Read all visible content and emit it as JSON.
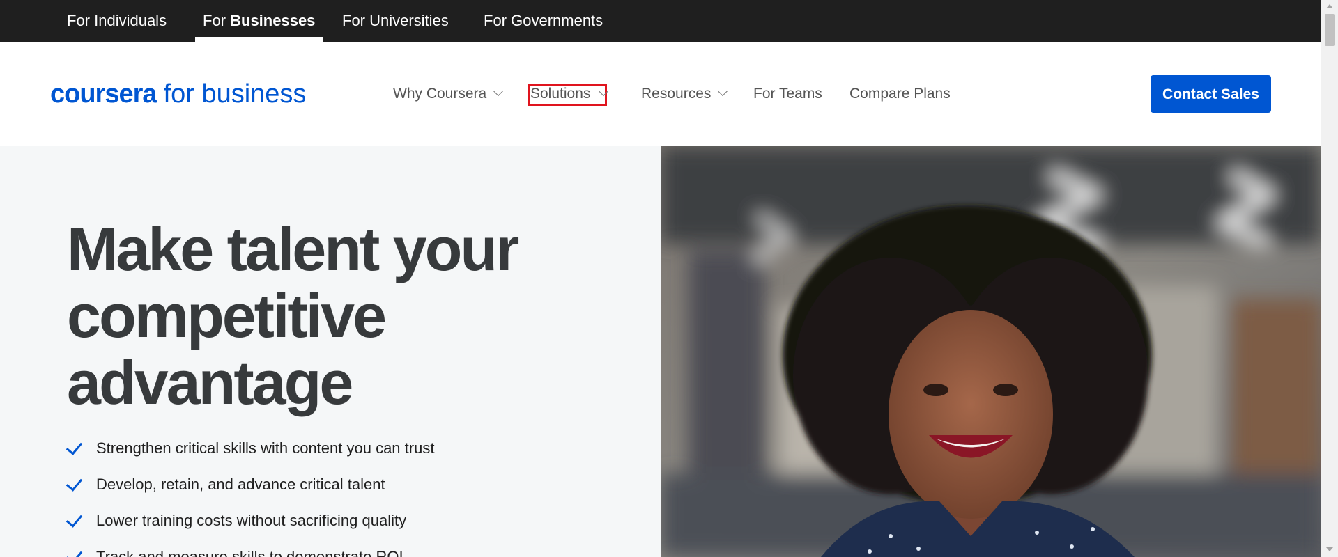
{
  "audience_tabs": [
    {
      "label": "For Individuals"
    },
    {
      "prefix": "For ",
      "strong": "Businesses"
    },
    {
      "label": "For Universities"
    },
    {
      "label": "For Governments"
    }
  ],
  "logo": {
    "brand": "coursera",
    "suffix": "for business"
  },
  "nav": {
    "why_coursera": "Why Coursera",
    "solutions": "Solutions",
    "resources": "Resources",
    "for_teams": "For Teams",
    "compare_plans": "Compare Plans"
  },
  "cta": {
    "contact_sales": "Contact Sales"
  },
  "hero": {
    "headline": [
      "Make talent your",
      "competitive",
      "advantage"
    ],
    "bullets": [
      "Strengthen critical skills with content you can trust",
      "Develop, retain, and advance critical talent",
      "Lower training costs without sacrificing quality",
      "Track and measure skills to demonstrate ROI"
    ]
  },
  "colors": {
    "brand_blue": "#0056d2",
    "topbar": "#1f1f1f",
    "hero_bg": "#f5f7f8",
    "highlight_box": "#e0141e"
  }
}
